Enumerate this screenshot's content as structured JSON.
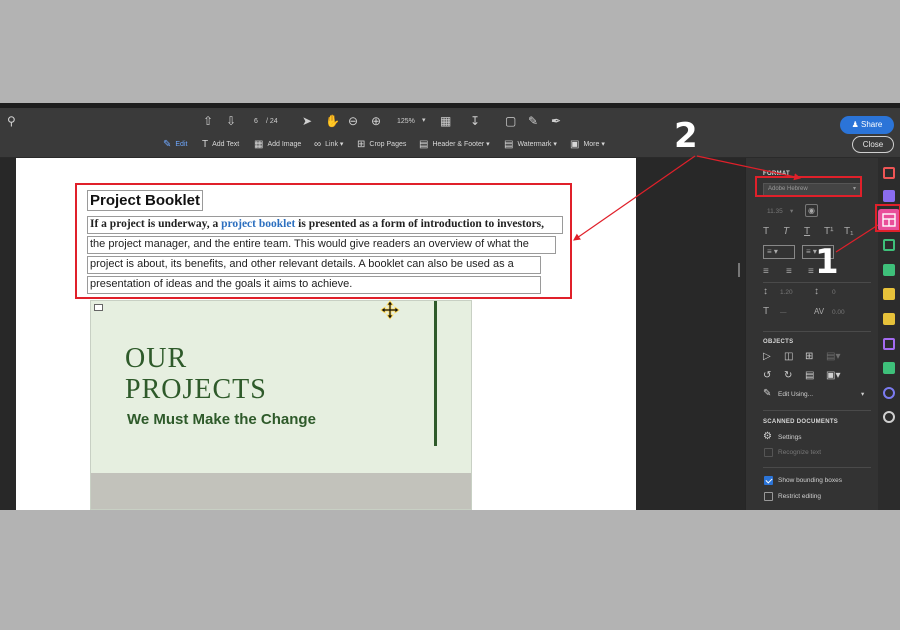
{
  "toolbar": {
    "page_current": "6",
    "page_total": "/ 24",
    "zoom": "125%",
    "share_label": "Share",
    "close_label": "Close"
  },
  "edit_toolbar": {
    "edit": "Edit",
    "add_text": "Add Text",
    "add_image": "Add Image",
    "link": "Link",
    "crop_pages": "Crop Pages",
    "header_footer": "Header & Footer",
    "watermark": "Watermark",
    "more": "More"
  },
  "document": {
    "title": "Project Booklet",
    "line1_before": "If a project is underway, a ",
    "line1_link": "project booklet",
    "line1_after": " is presented as a form of introduction to investors,",
    "line2": "the project manager, and the entire team. This would give readers an overview of what the",
    "line3": "project is about, its benefits, and other relevant details. A booklet can also be used as a",
    "line4": "presentation of ideas and the goals it aims to achieve.",
    "image_heading_1": "OUR",
    "image_heading_2": "PROJECTS",
    "image_tagline": "We Must Make the Change"
  },
  "panel": {
    "format_title": "FORMAT",
    "font_name": "Adobe Hebrew",
    "font_size": "11.35",
    "objects_title": "OBJECTS",
    "edit_using": "Edit Using...",
    "scanned_title": "SCANNED DOCUMENTS",
    "settings": "Settings",
    "recognize_text": "Recognize text",
    "show_bounding": "Show bounding boxes",
    "restrict_editing": "Restrict editing",
    "line_spacing": "1.20",
    "para_spacing": "0",
    "char_spacing": "0.00"
  },
  "annotations": {
    "label1": "1",
    "label2": "2",
    "color": "#e0202a"
  },
  "colors": {
    "accent": "#2b74d8",
    "active_tool": "#e94f9a",
    "brand_green": "#2e5a2a"
  }
}
